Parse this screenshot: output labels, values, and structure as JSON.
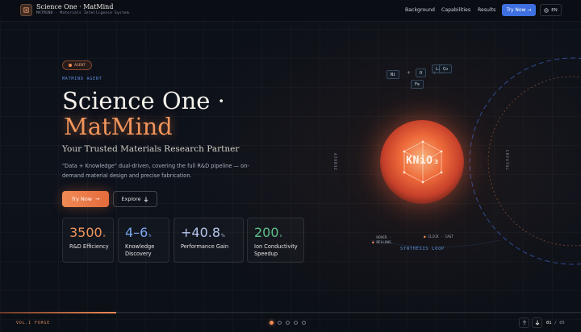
{
  "header": {
    "brand_title": "Science One · MatMind",
    "brand_subtitle": "MATMIND · Materials Intelligence System",
    "nav": [
      "Background",
      "Capabilities",
      "Results"
    ],
    "try_now": "Try Now →",
    "lang": "EN"
  },
  "hero": {
    "badge": "AGENT",
    "eyebrow": "MATMIND AGENT",
    "title_line1": "Science One ·",
    "title_line2": "MatMind",
    "subtitle": "Your Trusted Materials Research Partner",
    "description": "\"Data + Knowledge\" dual-driven, covering the full R&D pipeline — on-demand material design and precise fabrication.",
    "try_now": "Try Now",
    "explore": "Explore"
  },
  "stats": [
    {
      "value": "3500",
      "unit": "x",
      "label": "R&D Efficiency",
      "color": "#f0955c"
    },
    {
      "value": "4–6",
      "unit": "h",
      "label": "Knowledge Discovery",
      "color": "#7aa8f0"
    },
    {
      "value": "+40.8",
      "unit": "%",
      "label": "Performance Gain",
      "color": "#b6c8ee"
    },
    {
      "value": "200",
      "unit": "x",
      "label": "Ion Conductivity Speedup",
      "color": "#5fc28a"
    }
  ],
  "visual": {
    "label_left": "ATOMIC",
    "label_right": "CRYSTAL",
    "elements": [
      "Ni",
      "O",
      "Li",
      "Co",
      "Fe"
    ],
    "compound": "KNiO₃",
    "hover_tag": "HOVER · BELLOWS",
    "click_tag": "CLICK · CAST",
    "synthesis": "SYNTHESIS LOOP"
  },
  "footer": {
    "volume": "VOL.I FORGE",
    "progress": 0.2,
    "page_current": "01",
    "page_total": "/ 05"
  },
  "colors": {
    "accent": "#ef8a55",
    "primary_blue": "#3e6fe0",
    "background": "#0c1018"
  }
}
